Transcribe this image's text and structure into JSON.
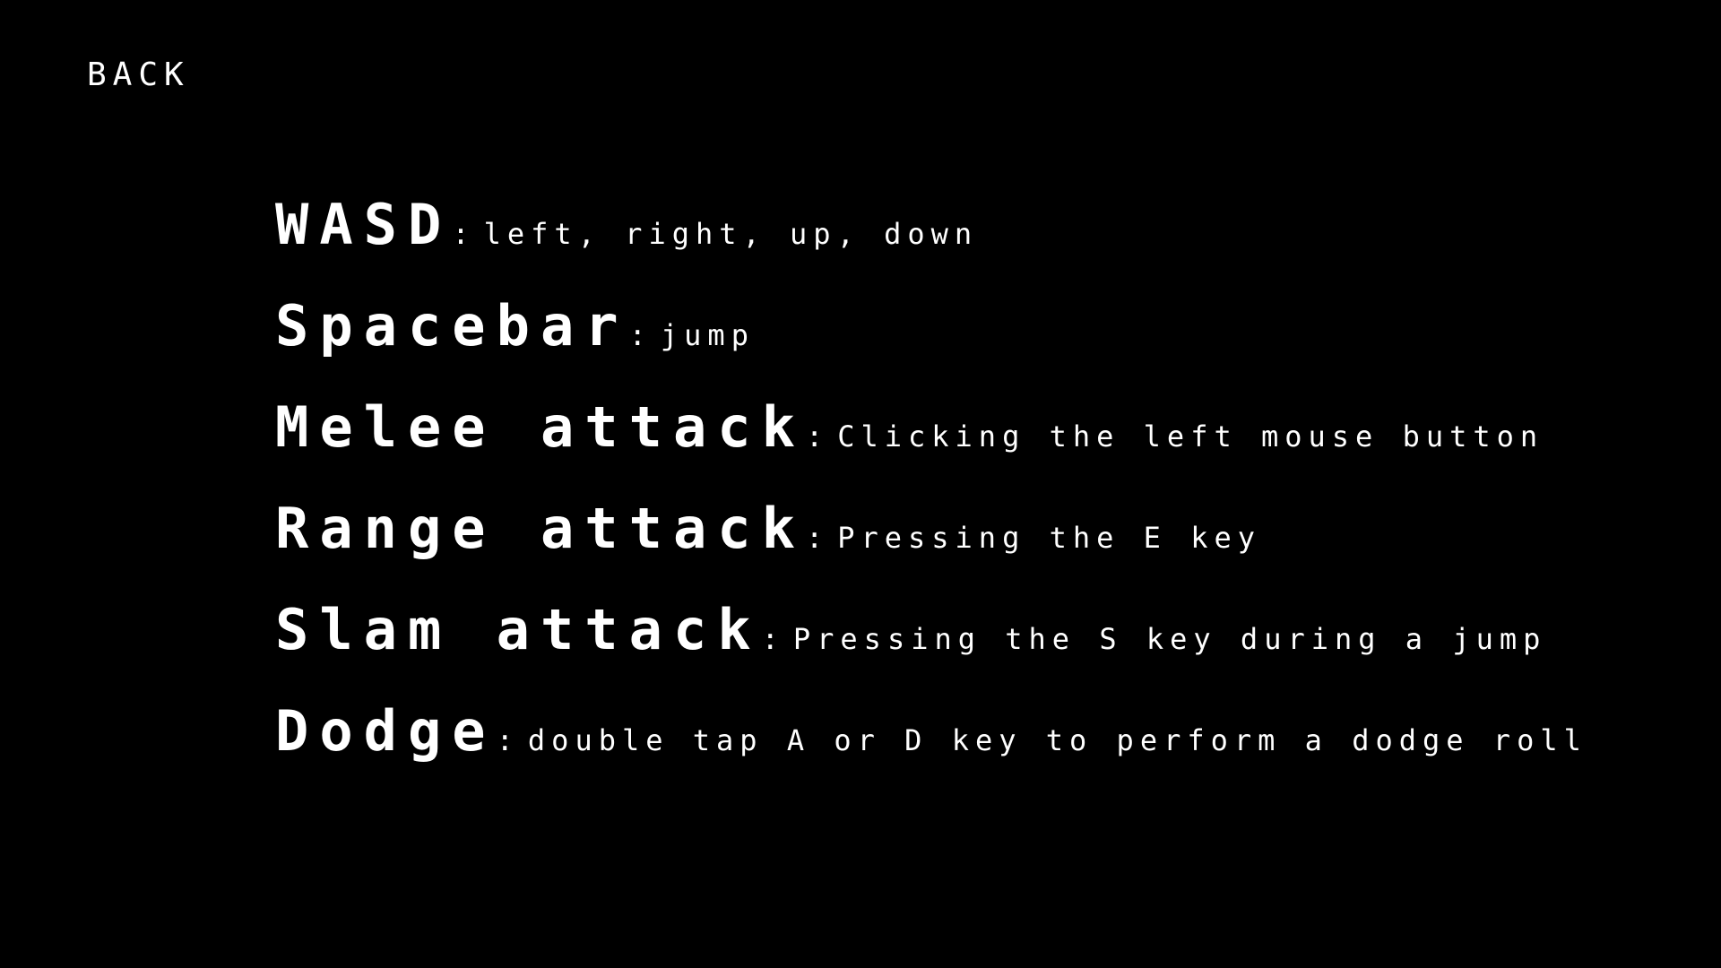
{
  "back_label": "BACK",
  "controls": [
    {
      "key": "WASD",
      "separator": ":",
      "description": "left, right, up, down"
    },
    {
      "key": "Spacebar",
      "separator": ":",
      "description": "jump"
    },
    {
      "key": "Melee attack",
      "separator": ":",
      "description": "Clicking the left mouse button"
    },
    {
      "key": "Range attack",
      "separator": ":",
      "description": "Pressing the E key"
    },
    {
      "key": "Slam attack",
      "separator": ":",
      "description": "Pressing the S key during a jump"
    },
    {
      "key": "Dodge",
      "separator": ":",
      "description": "double tap A or D key to perform a dodge roll"
    }
  ],
  "colors": {
    "background": "#000000",
    "text": "#ffffff"
  }
}
